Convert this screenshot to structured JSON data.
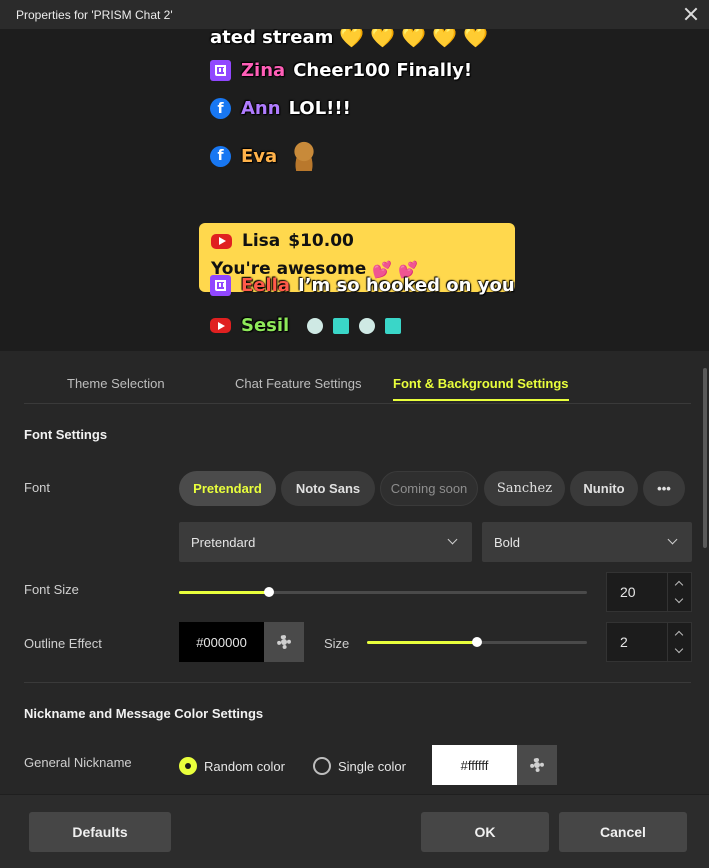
{
  "window": {
    "title": "Properties for 'PRISM Chat 2'"
  },
  "preview": {
    "partial_line": {
      "text": "ated stream"
    },
    "lines": [
      {
        "platform": "twitch-icon",
        "nick": "Zina",
        "nick_color": "#ff5fb8",
        "message": "Cheer100 Finally!"
      },
      {
        "platform": "facebook-icon",
        "nick": "Ann",
        "nick_color": "#b07cff",
        "message": "LOL!!!"
      },
      {
        "platform": "facebook-icon",
        "nick": "Eva",
        "nick_color": "#ffb24a",
        "message": ""
      },
      {
        "platform": "twitch-icon",
        "nick": "Eella",
        "nick_color": "#ff5a4a",
        "message": "I’m so hooked on you"
      },
      {
        "platform": "youtube-icon",
        "nick": "Sesil",
        "nick_color": "#8ee85a",
        "message": ""
      }
    ],
    "superchat": {
      "platform": "youtube-icon",
      "nick": "Lisa",
      "amount": "$10.00",
      "message": "You're awesome",
      "background": "#ffd84d"
    }
  },
  "tabs": [
    {
      "label": "Theme Selection",
      "active": false
    },
    {
      "label": "Chat Feature Settings",
      "active": false
    },
    {
      "label": "Font & Background Settings",
      "active": true
    }
  ],
  "font_settings": {
    "title": "Font Settings",
    "font_label": "Font",
    "font_chips": [
      {
        "label": "Pretendard",
        "state": "active"
      },
      {
        "label": "Noto Sans",
        "state": "normal"
      },
      {
        "label": "Coming soon",
        "state": "disabled"
      },
      {
        "label": "Sanchez",
        "state": "normal"
      },
      {
        "label": "Nunito",
        "state": "normal"
      },
      {
        "label": "•••",
        "state": "more"
      }
    ],
    "font_family_select": "Pretendard",
    "font_weight_select": "Bold",
    "font_size_label": "Font Size",
    "font_size_value": "20",
    "font_size_fraction": 0.22,
    "outline_label": "Outline Effect",
    "outline_color": "#000000",
    "outline_size_label": "Size",
    "outline_size_value": "2",
    "outline_size_fraction": 0.5
  },
  "nickname_settings": {
    "title": "Nickname and Message Color Settings",
    "general_nickname_label": "General Nickname",
    "random_color_label": "Random color",
    "single_color_label": "Single color",
    "selected": "random",
    "single_color_value": "#ffffff"
  },
  "footer": {
    "defaults_label": "Defaults",
    "ok_label": "OK",
    "cancel_label": "Cancel"
  },
  "accent_color": "#e9ff3c"
}
